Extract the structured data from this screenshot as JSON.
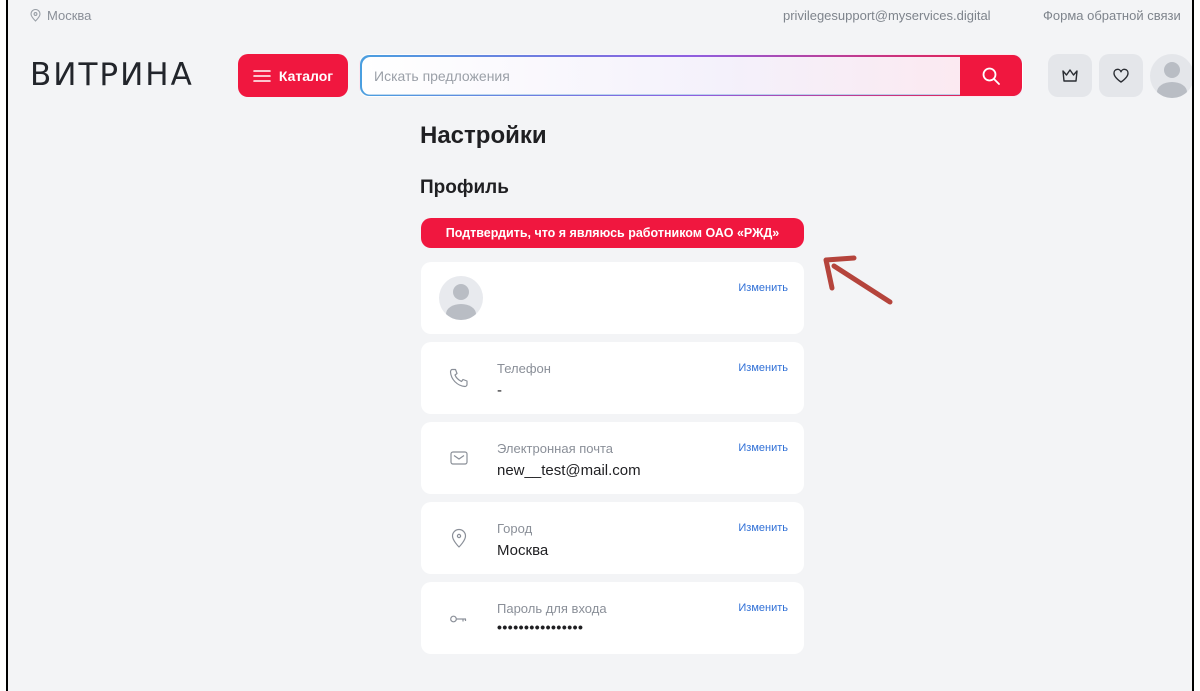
{
  "topbar": {
    "city": "Москва",
    "email": "privilegesupport@myservices.digital",
    "feedback": "Форма обратной связи"
  },
  "header": {
    "logo": "ВИТРИНА",
    "catalog_label": "Каталог",
    "search_placeholder": "Искать предложения"
  },
  "page": {
    "title": "Настройки",
    "section_title": "Профиль",
    "confirm_button": "Подтвердить, что я являюсь работником ОАО «РЖД»"
  },
  "profile": {
    "edit_label": "Изменить",
    "fields": [
      {
        "label": "Телефон",
        "value": "-",
        "icon": "phone-icon"
      },
      {
        "label": "Электронная почта",
        "value": "new__test@mail.com",
        "icon": "mail-icon"
      },
      {
        "label": "Город",
        "value": "Москва",
        "icon": "location-icon"
      },
      {
        "label": "Пароль для входа",
        "value": "••••••••••••••••",
        "icon": "key-icon"
      }
    ]
  },
  "colors": {
    "accent": "#f0173f",
    "link": "#2f6fd6",
    "background": "#f3f4f6",
    "annotation_arrow": "#b5443c"
  }
}
